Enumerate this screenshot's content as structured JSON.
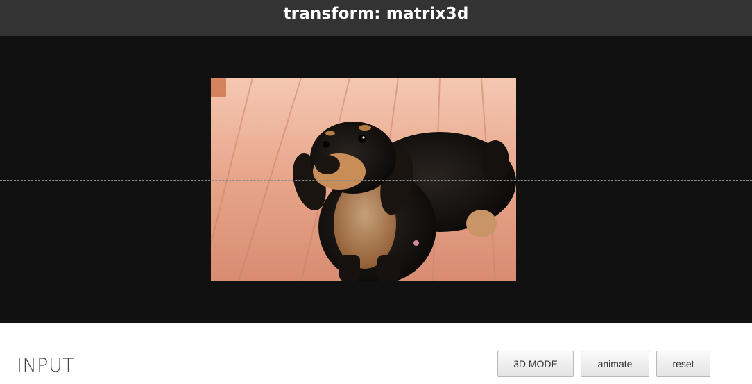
{
  "header": {
    "title": "transform: matrix3d"
  },
  "stage": {
    "image_subject": "dachshund on wooden deck"
  },
  "controls": {
    "section_label": "INPUT",
    "buttons": {
      "mode_3d": "3D MODE",
      "animate": "animate",
      "reset": "reset"
    }
  },
  "colors": {
    "header_bg": "#333333",
    "stage_bg": "#111111",
    "guide_line": "#8a8a8a",
    "button_border": "#b8b8b8"
  }
}
